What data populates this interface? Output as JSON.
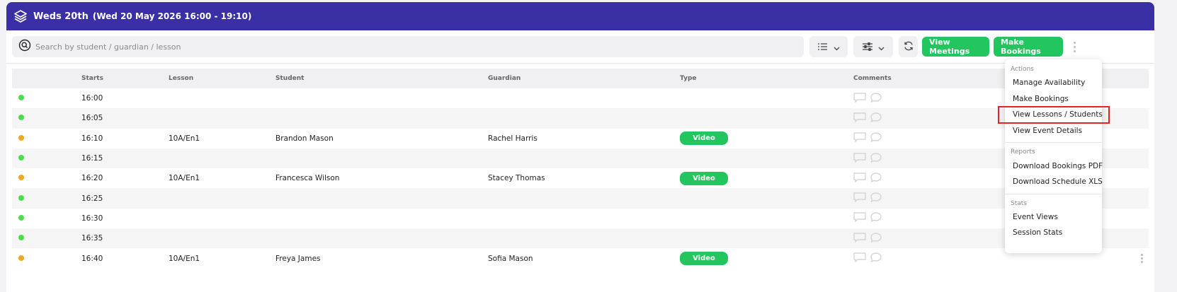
{
  "header": {
    "title": "Weds 20th",
    "subtitle": "(Wed 20 May 2026 16:00 - 19:10)"
  },
  "search": {
    "placeholder": "Search by student / guardian / lesson"
  },
  "toolbar": {
    "view_meetings_label": "View Meetings",
    "make_bookings_label": "Make Bookings"
  },
  "table": {
    "columns": [
      "Starts",
      "Lesson",
      "Student",
      "Guardian",
      "Type",
      "Comments"
    ],
    "rows": [
      {
        "status": "green",
        "starts": "16:00",
        "lesson": "",
        "student": "",
        "guardian": "",
        "type": ""
      },
      {
        "status": "green",
        "starts": "16:05",
        "lesson": "",
        "student": "",
        "guardian": "",
        "type": ""
      },
      {
        "status": "orange",
        "starts": "16:10",
        "lesson": "10A/En1",
        "student": "Brandon Mason",
        "guardian": "Rachel Harris",
        "type": "Video"
      },
      {
        "status": "green",
        "starts": "16:15",
        "lesson": "",
        "student": "",
        "guardian": "",
        "type": ""
      },
      {
        "status": "orange",
        "starts": "16:20",
        "lesson": "10A/En1",
        "student": "Francesca Wilson",
        "guardian": "Stacey Thomas",
        "type": "Video"
      },
      {
        "status": "green",
        "starts": "16:25",
        "lesson": "",
        "student": "",
        "guardian": "",
        "type": ""
      },
      {
        "status": "green",
        "starts": "16:30",
        "lesson": "",
        "student": "",
        "guardian": "",
        "type": ""
      },
      {
        "status": "green",
        "starts": "16:35",
        "lesson": "",
        "student": "",
        "guardian": "",
        "type": ""
      },
      {
        "status": "orange",
        "starts": "16:40",
        "lesson": "10A/En1",
        "student": "Freya James",
        "guardian": "Sofia Mason",
        "type": "Video"
      }
    ]
  },
  "menu": {
    "actions_heading": "Actions",
    "actions": [
      "Manage Availability",
      "Make Bookings",
      "View Lessons / Students",
      "View Event Details"
    ],
    "reports_heading": "Reports",
    "reports": [
      "Download Bookings PDF",
      "Download Schedule XLS"
    ],
    "stats_heading": "Stats",
    "stats": [
      "Event Views",
      "Session Stats"
    ]
  },
  "colors": {
    "header": "#3a2fa5",
    "accent_green": "#22c55e",
    "status_green": "#4ade4a",
    "status_orange": "#f5a623",
    "highlight_red": "#e02424"
  },
  "icons": {
    "logo": "layers-icon",
    "search": "search-icon",
    "list_view": "list-icon",
    "filter": "sliders-icon",
    "refresh": "refresh-icon",
    "more": "kebab-icon",
    "comment": "comment-bubble-icon"
  }
}
